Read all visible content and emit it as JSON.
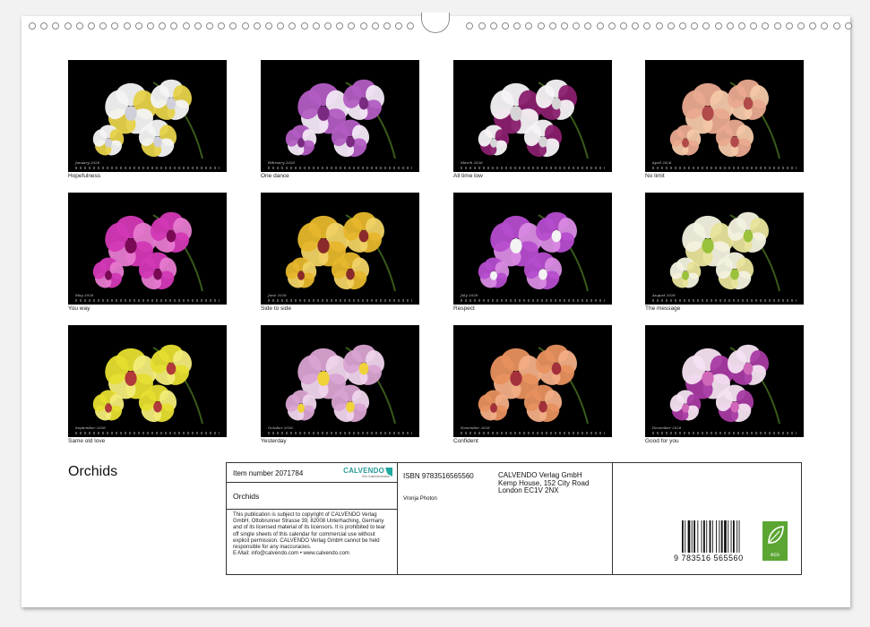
{
  "calendar_title": "Orchids",
  "months": [
    {
      "caption": "Hopefulness",
      "month": "January 2026",
      "palette": "white"
    },
    {
      "caption": "One dance",
      "month": "February 2026",
      "palette": "purple-spotted"
    },
    {
      "caption": "All time low",
      "month": "March 2026",
      "palette": "white-magenta"
    },
    {
      "caption": "No limit",
      "month": "April 2026",
      "palette": "peach"
    },
    {
      "caption": "You way",
      "month": "May 2026",
      "palette": "magenta"
    },
    {
      "caption": "Side to side",
      "month": "June 2026",
      "palette": "yellow-red"
    },
    {
      "caption": "Respect",
      "month": "July 2026",
      "palette": "violet"
    },
    {
      "caption": "The message",
      "month": "August 2026",
      "palette": "cream"
    },
    {
      "caption": "Same old love",
      "month": "September 2026",
      "palette": "yellow"
    },
    {
      "caption": "Yesterday",
      "month": "October 2026",
      "palette": "lilac"
    },
    {
      "caption": "Confident",
      "month": "November 2026",
      "palette": "orange"
    },
    {
      "caption": "Good for you",
      "month": "December 2026",
      "palette": "striped"
    }
  ],
  "info": {
    "item_number": "Item number 2071784",
    "brand": "CALVENDO",
    "brand_sub": "Ihre Kalendermarke",
    "product_title": "Orchids",
    "copyright_text": "This publication is subject to copyright of CALVENDO Verlag GmbH, Ottobrunner Strasse 39, 82008 Unterhaching, Germany and of its licensed material of its licensors. It is prohibited to tear off single sheets of this calendar for commercial use without explicit permission. CALVENDO Verlag GmbH cannot be held responsible for any inaccuracies.",
    "contact": "E-Mail: info@calvendo.com • www.calvendo.com",
    "isbn": "ISBN 9783516565560",
    "publisher_line1": "CALVENDO Verlag GmbH",
    "publisher_line2": "Kemp House, 152 City Road",
    "publisher_line3": "London EC1V 2NX",
    "author": "Vronja Photon",
    "barcode_number": "9 783516 565560",
    "eco_label": "eco"
  },
  "colors": {
    "white": [
      "#f4f4f6",
      "#e6d24a",
      "#cfd0da"
    ],
    "purple-spotted": [
      "#b25cc3",
      "#f3e8f5",
      "#7a2a80"
    ],
    "white-magenta": [
      "#f5f3f5",
      "#8a1f6e",
      "#d6d4d6"
    ],
    "peach": [
      "#e9a98f",
      "#f3c8a8",
      "#b24a4a"
    ],
    "magenta": [
      "#d338b5",
      "#e77ad0",
      "#7a0a55"
    ],
    "yellow-red": [
      "#e7b72c",
      "#f1d265",
      "#8a2a2a"
    ],
    "violet": [
      "#b54ccd",
      "#d98be3",
      "#f3f3f3"
    ],
    "cream": [
      "#f3f2e0",
      "#e8e39a",
      "#9ac23a"
    ],
    "yellow": [
      "#e6de2f",
      "#f2ec7a",
      "#b23a3a"
    ],
    "lilac": [
      "#d9a3d2",
      "#efd5ec",
      "#f0d23a"
    ],
    "orange": [
      "#e7905e",
      "#f2ae86",
      "#a3303a"
    ],
    "striped": [
      "#f4e2f1",
      "#a83aa3",
      "#d067b8"
    ]
  }
}
